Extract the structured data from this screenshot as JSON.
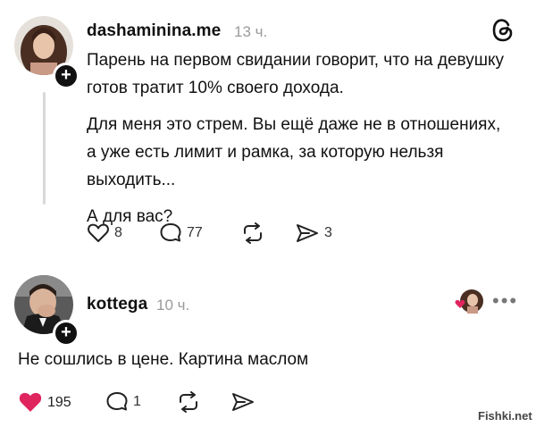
{
  "post": {
    "username": "dashaminina.me",
    "time": "13 ч.",
    "paragraphs": [
      "Парень на первом свидании говорит, что на девушку готов тратит 10% своего дохода.",
      "Для меня это стрем. Вы ещё даже не в отношениях, а уже есть лимит и рамка, за которую нельзя выходить...",
      "А для вас?"
    ],
    "likes": "8",
    "comments": "77",
    "shares": "3"
  },
  "reply": {
    "username": "kottega",
    "time": "10 ч.",
    "text": "Не сошлись в цене. Картина маслом",
    "likes": "195",
    "comments": "1",
    "more": "•••"
  },
  "watermark": "Fishki.net",
  "colors": {
    "like_active": "#e0245e",
    "muted": "#9a9a9a",
    "thread_line": "#d8d8d8"
  },
  "icons": {
    "threads_logo": "@",
    "plus": "+"
  }
}
